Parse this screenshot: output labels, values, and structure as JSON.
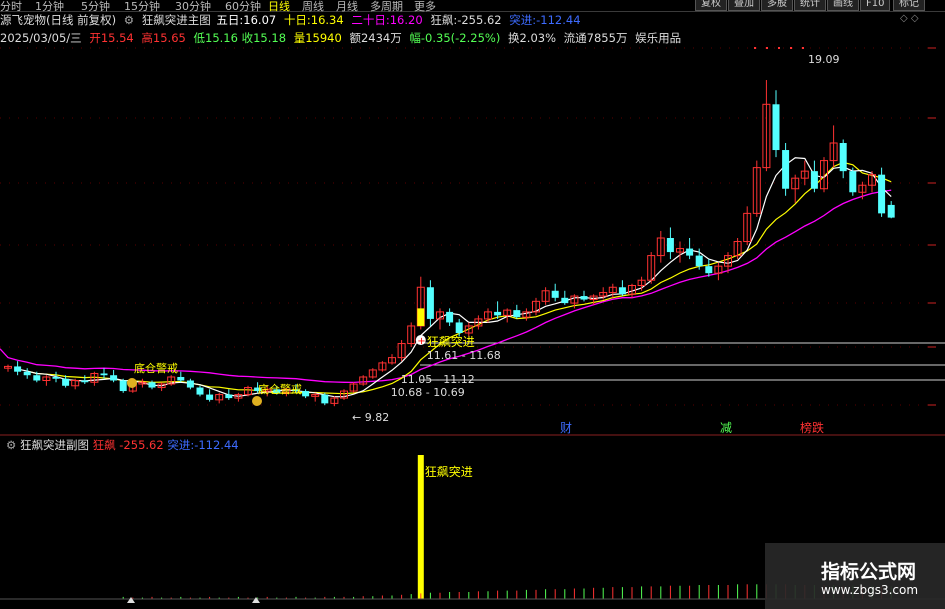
{
  "period_tabs": [
    "分时",
    "1分钟",
    "5分钟",
    "15分钟",
    "30分钟",
    "60分钟",
    "日线",
    "周线",
    "月线",
    "多周期",
    "更多"
  ],
  "active_tab": "日线",
  "right_buttons": [
    "复权",
    "叠加",
    "多股",
    "统计",
    "画线",
    "F10",
    "标记"
  ],
  "legend": {
    "title": "狂飙突进主图",
    "ma5_label": "五日:",
    "ma5": "16.07",
    "ma10_label": "十日:",
    "ma10": "16.34",
    "ma20_label": "二十日:",
    "ma20": "16.20",
    "kb_label": "狂飙:",
    "kb": "-255.62",
    "tj_label": "突进:",
    "tj": "-112.44"
  },
  "stock_name": "源飞宠物(日线 前复权)",
  "info": {
    "date": "2025/03/05/三",
    "open_label": "开",
    "open": "15.54",
    "high_label": "高",
    "high": "15.65",
    "low_label": "低",
    "low": "15.16",
    "close_label": "收",
    "close": "15.18",
    "vol_label": "量",
    "vol": "15940",
    "amt_label": "额",
    "amt": "2434万",
    "chg_label": "幅",
    "chg": "-0.35(-2.25%)",
    "turn_label": "换",
    "turn": "2.03%",
    "float_label": "流通",
    "float": "7855万",
    "concept": "娱乐用品"
  },
  "annotations": {
    "high_price": "19.09",
    "low_price": "9.82",
    "signal": "狂飙突进",
    "range1": "11.61 - 11.68",
    "range2": "11.05 - 11.12",
    "range3": "10.68 - 10.69",
    "left_label1": "底仓警戒",
    "left_label2": "底仓警戒",
    "marker_cai": "财",
    "marker_jian": "减",
    "marker_bang": "榜跌"
  },
  "sub_chart": {
    "title": "狂飙突进副图",
    "kb_label": "狂飙",
    "kb": "-255.62",
    "tj_label": "突进:",
    "tj": "-112.44",
    "signal": "狂飙突进"
  },
  "watermark": {
    "title": "指标公式网",
    "url": "www.zbgs3.com"
  },
  "colors": {
    "up": "#ff3232",
    "down": "#54ffff",
    "ma5": "#ffffff",
    "ma10": "#ffff00",
    "ma20": "#ff00ff",
    "signal": "#ffff00"
  },
  "candles": [
    [
      10.9,
      11.0,
      10.8,
      10.95
    ],
    [
      10.95,
      11.1,
      10.7,
      10.8
    ],
    [
      10.8,
      10.9,
      10.6,
      10.7
    ],
    [
      10.7,
      10.8,
      10.5,
      10.55
    ],
    [
      10.55,
      10.7,
      10.4,
      10.65
    ],
    [
      10.65,
      10.8,
      10.5,
      10.6
    ],
    [
      10.6,
      10.7,
      10.35,
      10.4
    ],
    [
      10.4,
      10.6,
      10.3,
      10.55
    ],
    [
      10.55,
      10.7,
      10.45,
      10.5
    ],
    [
      10.5,
      10.8,
      10.4,
      10.75
    ],
    [
      10.75,
      10.9,
      10.6,
      10.7
    ],
    [
      10.7,
      10.85,
      10.5,
      10.55
    ],
    [
      10.55,
      10.6,
      10.2,
      10.25
    ],
    [
      10.25,
      10.5,
      10.2,
      10.45
    ],
    [
      10.45,
      10.6,
      10.35,
      10.5
    ],
    [
      10.5,
      10.55,
      10.3,
      10.35
    ],
    [
      10.35,
      10.5,
      10.25,
      10.45
    ],
    [
      10.45,
      10.7,
      10.4,
      10.65
    ],
    [
      10.65,
      10.8,
      10.5,
      10.55
    ],
    [
      10.55,
      10.6,
      10.3,
      10.35
    ],
    [
      10.35,
      10.4,
      10.1,
      10.15
    ],
    [
      10.15,
      10.3,
      9.95,
      10.0
    ],
    [
      10.0,
      10.2,
      9.9,
      10.15
    ],
    [
      10.15,
      10.3,
      10.0,
      10.05
    ],
    [
      10.05,
      10.2,
      9.95,
      10.15
    ],
    [
      10.15,
      10.4,
      10.1,
      10.35
    ],
    [
      10.35,
      10.5,
      10.2,
      10.25
    ],
    [
      10.25,
      10.4,
      10.1,
      10.3
    ],
    [
      10.3,
      10.4,
      10.15,
      10.2
    ],
    [
      10.2,
      10.35,
      10.1,
      10.3
    ],
    [
      10.3,
      10.45,
      10.2,
      10.25
    ],
    [
      10.25,
      10.3,
      10.05,
      10.1
    ],
    [
      10.1,
      10.2,
      9.95,
      10.15
    ],
    [
      10.15,
      10.2,
      9.85,
      9.9
    ],
    [
      9.9,
      10.1,
      9.82,
      10.05
    ],
    [
      10.05,
      10.3,
      10.0,
      10.25
    ],
    [
      10.25,
      10.5,
      10.2,
      10.45
    ],
    [
      10.45,
      10.7,
      10.4,
      10.65
    ],
    [
      10.65,
      10.9,
      10.6,
      10.85
    ],
    [
      10.85,
      11.1,
      10.8,
      11.05
    ],
    [
      11.05,
      11.3,
      11.0,
      11.2
    ],
    [
      11.2,
      11.7,
      11.1,
      11.6
    ],
    [
      11.6,
      12.2,
      11.5,
      12.1
    ],
    [
      12.1,
      13.5,
      12.0,
      13.2
    ],
    [
      13.2,
      13.4,
      12.1,
      12.3
    ],
    [
      12.3,
      12.6,
      12.0,
      12.5
    ],
    [
      12.5,
      12.6,
      12.1,
      12.2
    ],
    [
      12.2,
      12.3,
      11.8,
      11.9
    ],
    [
      11.9,
      12.2,
      11.8,
      12.1
    ],
    [
      12.1,
      12.4,
      12.0,
      12.3
    ],
    [
      12.3,
      12.6,
      12.2,
      12.5
    ],
    [
      12.5,
      12.8,
      12.3,
      12.4
    ],
    [
      12.4,
      12.6,
      12.2,
      12.55
    ],
    [
      12.55,
      12.7,
      12.3,
      12.35
    ],
    [
      12.35,
      12.6,
      12.25,
      12.5
    ],
    [
      12.5,
      12.9,
      12.4,
      12.8
    ],
    [
      12.8,
      13.2,
      12.7,
      13.1
    ],
    [
      13.1,
      13.3,
      12.8,
      12.9
    ],
    [
      12.9,
      13.1,
      12.7,
      12.75
    ],
    [
      12.75,
      13.0,
      12.6,
      12.95
    ],
    [
      12.95,
      13.1,
      12.8,
      12.85
    ],
    [
      12.85,
      13.0,
      12.7,
      12.95
    ],
    [
      12.95,
      13.2,
      12.85,
      13.05
    ],
    [
      13.05,
      13.3,
      12.9,
      13.2
    ],
    [
      13.2,
      13.4,
      12.95,
      13.0
    ],
    [
      13.0,
      13.3,
      12.9,
      13.25
    ],
    [
      13.25,
      13.5,
      13.1,
      13.4
    ],
    [
      13.4,
      14.2,
      13.3,
      14.1
    ],
    [
      14.1,
      14.8,
      13.9,
      14.6
    ],
    [
      14.6,
      14.9,
      14.0,
      14.2
    ],
    [
      14.2,
      14.5,
      13.9,
      14.3
    ],
    [
      14.3,
      14.6,
      14.0,
      14.1
    ],
    [
      14.1,
      14.3,
      13.7,
      13.8
    ],
    [
      13.8,
      14.0,
      13.5,
      13.6
    ],
    [
      13.6,
      13.9,
      13.4,
      13.8
    ],
    [
      13.8,
      14.2,
      13.6,
      14.1
    ],
    [
      14.1,
      14.6,
      14.0,
      14.5
    ],
    [
      14.5,
      15.5,
      14.4,
      15.3
    ],
    [
      15.3,
      16.8,
      15.2,
      16.6
    ],
    [
      16.6,
      19.09,
      16.5,
      18.4
    ],
    [
      18.4,
      18.8,
      16.9,
      17.1
    ],
    [
      17.1,
      17.3,
      15.8,
      16.0
    ],
    [
      16.0,
      16.4,
      15.6,
      16.3
    ],
    [
      16.3,
      16.8,
      16.1,
      16.5
    ],
    [
      16.5,
      16.8,
      15.9,
      16.0
    ],
    [
      16.0,
      16.9,
      15.9,
      16.8
    ],
    [
      16.8,
      17.8,
      16.6,
      17.3
    ],
    [
      17.3,
      17.4,
      16.3,
      16.5
    ],
    [
      16.5,
      16.6,
      15.8,
      15.9
    ],
    [
      15.9,
      16.2,
      15.7,
      16.1
    ],
    [
      16.1,
      16.5,
      15.9,
      16.4
    ],
    [
      16.4,
      16.6,
      15.2,
      15.3
    ],
    [
      15.54,
      15.65,
      15.16,
      15.18
    ]
  ],
  "volume_bars": [
    2,
    2,
    3,
    2,
    3,
    2,
    3,
    2,
    2,
    3,
    2,
    2,
    3,
    2,
    2,
    3,
    2,
    2,
    3,
    2,
    2,
    3,
    2,
    2,
    3,
    2,
    2,
    3,
    2,
    2,
    3,
    2,
    2,
    3,
    3,
    3,
    3,
    4,
    4,
    5,
    5,
    6,
    7,
    8,
    9,
    9,
    10,
    10,
    10,
    11,
    11,
    12,
    12,
    12,
    13,
    13,
    14,
    14,
    14,
    15,
    15,
    16,
    16,
    17,
    17,
    17,
    18,
    18,
    18,
    19,
    19,
    19,
    20,
    20,
    20,
    20,
    21,
    21,
    21,
    21,
    21,
    21,
    20,
    20,
    20,
    20,
    20,
    19,
    19,
    19,
    19,
    18,
    18
  ]
}
